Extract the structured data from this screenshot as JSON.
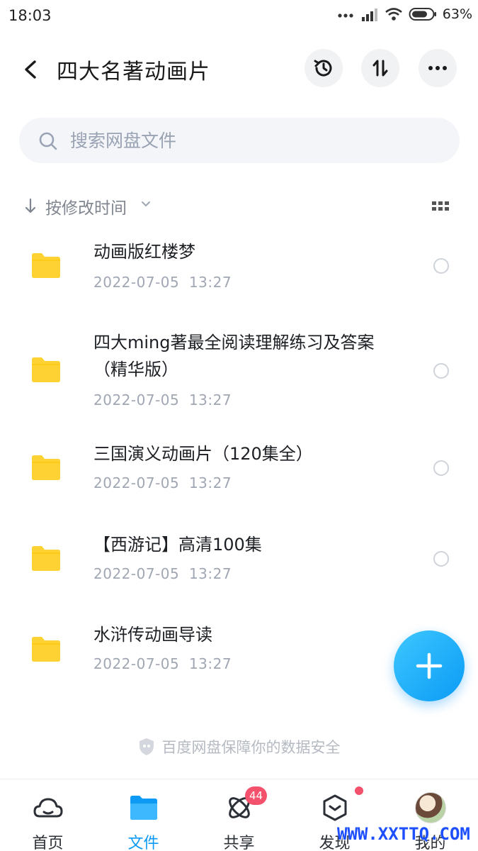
{
  "status_bar": {
    "time": "18:03",
    "battery": "63%"
  },
  "header": {
    "title": "四大名著动画片",
    "back_icon": "chevron-left-icon",
    "history_icon": "history-icon",
    "sort_icon": "sort-swap-icon",
    "more_icon": "more-icon"
  },
  "search": {
    "placeholder": "搜索网盘文件"
  },
  "sort_bar": {
    "label": "按修改时间"
  },
  "files": [
    {
      "name": "动画版红楼梦",
      "modified": "2022-07-05  13:27"
    },
    {
      "name": "四大ming著最全阅读理解练习及答案（精华版）",
      "modified": "2022-07-05  13:27"
    },
    {
      "name": "三国演义动画片（120集全）",
      "modified": "2022-07-05  13:27"
    },
    {
      "name": "【西游记】高清100集",
      "modified": "2022-07-05  13:27"
    },
    {
      "name": "水浒传动画导读",
      "modified": "2022-07-05  13:27"
    }
  ],
  "security_note": "百度网盘保障你的数据安全",
  "bottom_nav": {
    "items": [
      {
        "label": "首页",
        "icon": "cloud-home-icon"
      },
      {
        "label": "文件",
        "icon": "folder-icon"
      },
      {
        "label": "共享",
        "icon": "share-atom-icon",
        "badge": "44"
      },
      {
        "label": "发现",
        "icon": "discover-box-icon"
      },
      {
        "label": "我的",
        "icon": "avatar"
      }
    ],
    "active": "文件"
  },
  "watermark": "WWW.XXTTQ.COM",
  "colors": {
    "accent": "#0d9af5",
    "folder": "#ffd233",
    "badge": "#f4516c",
    "watermark": "#1d4fff"
  }
}
